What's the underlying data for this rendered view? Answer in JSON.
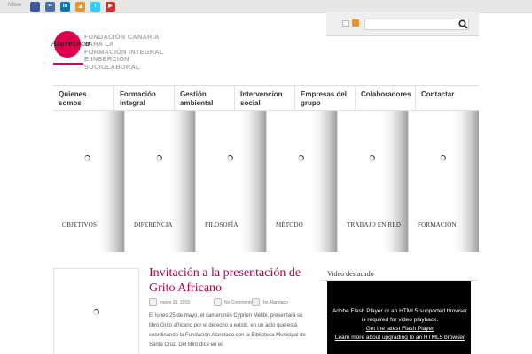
{
  "topbar": {
    "follow_label": "follow",
    "social": [
      {
        "name": "facebook",
        "glyph": "f",
        "color": "#3b5998"
      },
      {
        "name": "flickr",
        "glyph": "••",
        "color": "#4a6ea9"
      },
      {
        "name": "linkedin",
        "glyph": "in",
        "color": "#0e76a8"
      },
      {
        "name": "rss",
        "glyph": "◢",
        "color": "#f39325"
      },
      {
        "name": "twitter",
        "glyph": "t",
        "color": "#33ccff"
      },
      {
        "name": "youtube",
        "glyph": "▶",
        "color": "#d92c2c"
      }
    ]
  },
  "search": {
    "placeholder": "",
    "value": ""
  },
  "logo": {
    "wordmark": "Ataretaco",
    "brand_color": "#e0004d"
  },
  "org": {
    "lines": [
      "FUNDACIÓN CANARIA",
      "PARA LA",
      "FORMACIÓN INTEGRAL",
      "E INSERCIÓN",
      "SOCIOLABORAL"
    ]
  },
  "nav": [
    {
      "label": "Quienes somos"
    },
    {
      "label": "Formación integral"
    },
    {
      "label": "Gestión ambiental"
    },
    {
      "label": "Intervencion social"
    },
    {
      "label": "Empresas del grupo"
    },
    {
      "label": "Colaboradores"
    },
    {
      "label": "Contactar"
    }
  ],
  "features": [
    {
      "label": "OBJETIVOS"
    },
    {
      "label": "DIFERENCIA"
    },
    {
      "label": "FILOSOFÍA"
    },
    {
      "label": "MÉTODO"
    },
    {
      "label": "TRABAJO EN RED"
    },
    {
      "label": "FORMACIÓN"
    }
  ],
  "post": {
    "title": "Invitación a la presentación de Grito Africano",
    "date": "mayo 15, 2015",
    "comments": "No Comments",
    "author": "by Ataretaco",
    "excerpt": "El lunes 25 de mayo, el camerunés Cyprien Mélibi, presentará su libro Grito africano por el derecho a existir, en un acto que está coordinando la Fundación Ataretaco con la Biblioteca Municipal de Santa Cruz. Del libro dice en el"
  },
  "sidebar": {
    "video_title": "Video destacado",
    "video_msg_1": "Adobe Flash Player or an HTML5 supported browser",
    "video_msg_2": "is required for video playback.",
    "video_link_1": "Get the latest Flash Player",
    "video_link_2": "Learn more about upgrading to an HTML5 browser"
  }
}
